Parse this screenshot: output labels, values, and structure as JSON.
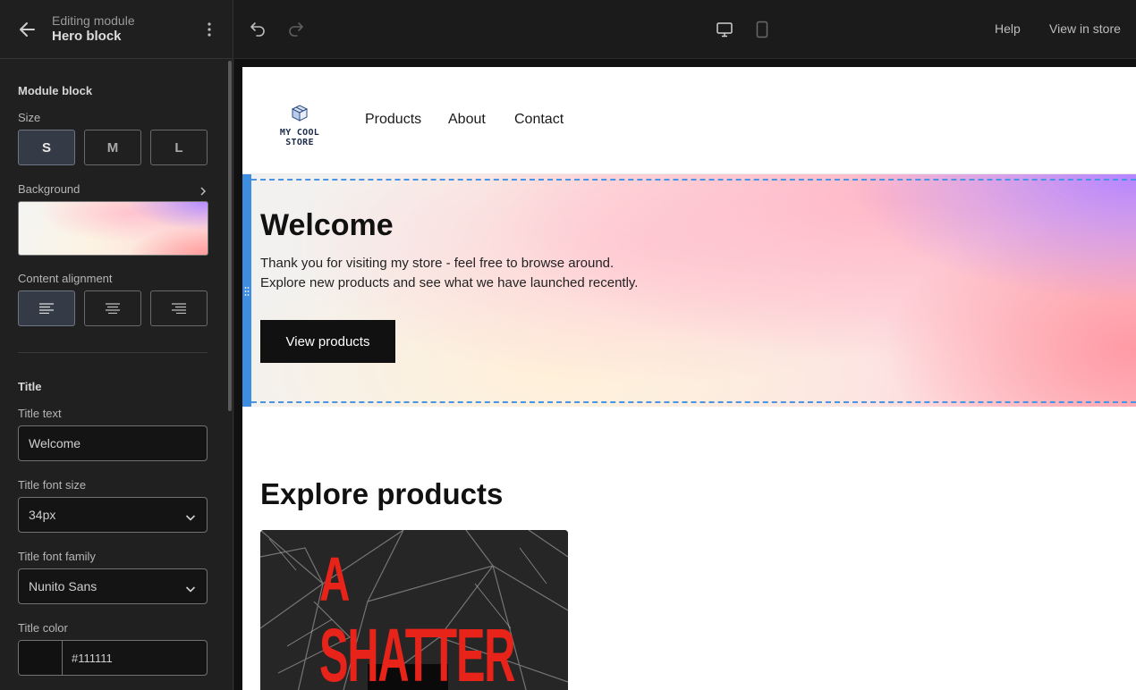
{
  "editor": {
    "header": {
      "subtitle": "Editing module",
      "title": "Hero block"
    },
    "module_block_label": "Module block",
    "size": {
      "label": "Size",
      "options": [
        "S",
        "M",
        "L"
      ],
      "selected": "S"
    },
    "background": {
      "label": "Background"
    },
    "content_alignment": {
      "label": "Content alignment",
      "options": [
        "left",
        "center",
        "right"
      ],
      "selected": "left"
    },
    "title_section": {
      "heading": "Title",
      "title_text_label": "Title text",
      "title_text_value": "Welcome",
      "font_size_label": "Title font size",
      "font_size_value": "34px",
      "font_family_label": "Title font family",
      "font_family_value": "Nunito Sans",
      "color_label": "Title color",
      "color_value": "#111111"
    }
  },
  "topbar": {
    "help": "Help",
    "view_in_store": "View in store",
    "device": "desktop"
  },
  "store": {
    "logo_text": "MY COOL STORE",
    "nav": [
      "Products",
      "About",
      "Contact"
    ],
    "hero": {
      "title": "Welcome",
      "text_line_1": "Thank you for visiting my store - feel free to browse around.",
      "text_line_2": "Explore new products and see what we have launched recently.",
      "button": "View products"
    },
    "section_title": "Explore products",
    "product_poster": {
      "line_1": "A",
      "line_2": "SHATTER"
    }
  },
  "colors": {
    "selection": "#3d8de0",
    "accent_dark": "#111111",
    "poster_red": "#e8231a"
  }
}
